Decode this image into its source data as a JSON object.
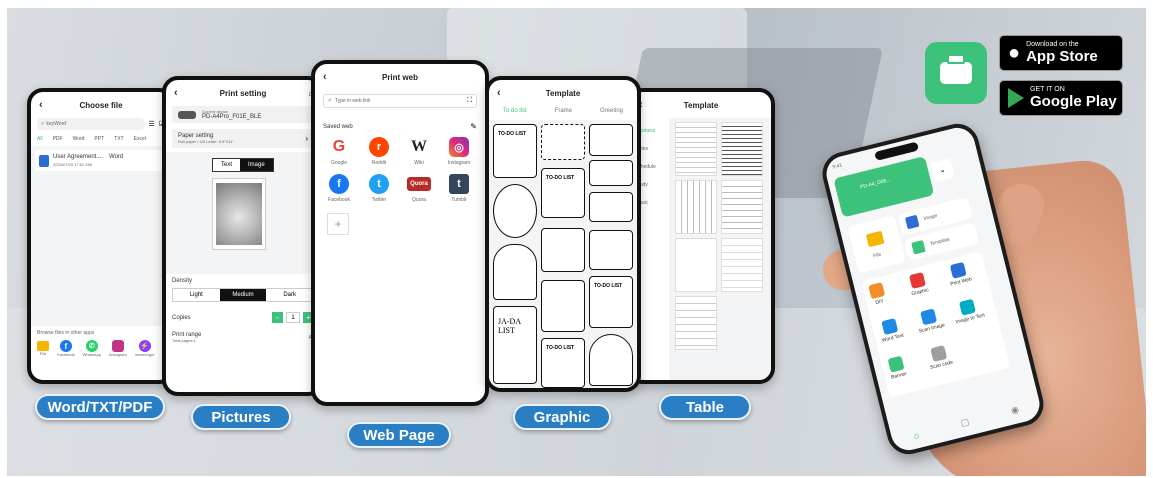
{
  "labels": {
    "word": "Word/TXT/PDF",
    "pictures": "Pictures",
    "webpage": "Web Page",
    "graphic": "Graphic",
    "table": "Table"
  },
  "choose_file": {
    "title": "Choose file",
    "search_placeholder": "keyWord",
    "tabs": [
      "All",
      "PDF",
      "Word",
      "PPT",
      "TXT",
      "Excel"
    ],
    "file_name": "User Agreement....",
    "file_type": "Word",
    "file_meta": "2024/07/03   17:51   28K",
    "browse_title": "Browse files in other apps",
    "apps": [
      "File",
      "Facebook",
      "WhatsApp",
      "Instagram",
      "messenger"
    ]
  },
  "print_setting": {
    "title": "Print setting",
    "device_label": "Current device",
    "device_name": "PD-A4Pro_F01E_BLE",
    "paper_title": "Paper setting",
    "paper_value": "Roll paper / US Letter: 8.5\"X11\"",
    "seg_text": "Text",
    "seg_image": "Image",
    "density_label": "Density",
    "density_options": [
      "Light",
      "Medium",
      "Dark"
    ],
    "copies_label": "Copies",
    "copies_value": "1",
    "range_label": "Print range",
    "range_sub": "Total pages:1",
    "range_value": "All"
  },
  "print_web": {
    "title": "Print web",
    "search_placeholder": "Type in web link",
    "saved_label": "Saved web",
    "sites": [
      {
        "name": "Google",
        "glyph": "G",
        "color": "#ea4335"
      },
      {
        "name": "Reddit",
        "glyph": "r",
        "color": "#ff4500"
      },
      {
        "name": "Wiki",
        "glyph": "W",
        "color": "#333333"
      },
      {
        "name": "Instagram",
        "glyph": "◎",
        "color": "#c13584"
      },
      {
        "name": "Facebook",
        "glyph": "f",
        "color": "#1877f2"
      },
      {
        "name": "Twitter",
        "glyph": "t",
        "color": "#1da1f2"
      },
      {
        "name": "Quora",
        "glyph": "Quora",
        "color": "#b92b27"
      },
      {
        "name": "Tumblr",
        "glyph": "t",
        "color": "#35465c"
      }
    ],
    "add_glyph": "+"
  },
  "template": {
    "title": "Template",
    "tabs": [
      "To do list",
      "Frame",
      "Greeting"
    ],
    "todo_text": "TO-DO LIST",
    "jada_text": "JA-DA LIST"
  },
  "table_screen": {
    "title": "Template",
    "categories": [
      "Business",
      "Notes",
      "Schedule",
      "Study",
      "Music"
    ]
  },
  "home": {
    "time": "9:41",
    "device": "PD-A4_D08...",
    "tiles": [
      "File",
      "Image",
      "Template",
      "DIY",
      "Graphic",
      "Print Web",
      "Word Text",
      "Scan Image",
      "Image to Text",
      "Banner",
      "Scan code"
    ]
  },
  "stores": {
    "apple_small": "Download on the",
    "apple_big": "App Store",
    "google_small": "GET IT ON",
    "google_big": "Google Play"
  },
  "colors": {
    "accent_green": "#3cc27a",
    "pill_blue": "#2a7fc4"
  }
}
